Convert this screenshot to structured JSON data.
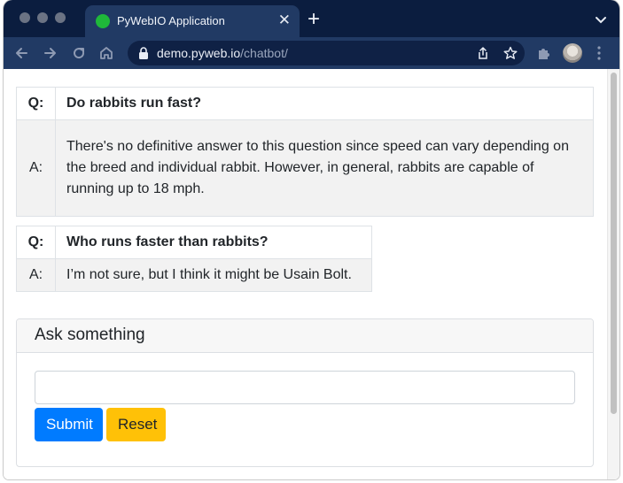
{
  "browser": {
    "tab_title": "PyWebIO Application",
    "tab_close_glyph": "✕",
    "new_tab_glyph": "+",
    "url_host": "demo.pyweb.io",
    "url_path": "/chatbot/",
    "favicon_color": "#1fb83a",
    "icons": [
      "back-arrow-icon",
      "forward-arrow-icon",
      "reload-icon",
      "home-icon",
      "lock-icon",
      "share-icon",
      "star-icon",
      "puzzle-extension-icon",
      "profile-avatar",
      "more-vert-icon",
      "tab-search-chevron-icon"
    ]
  },
  "chat": [
    {
      "q_label": "Q:",
      "question": "Do rabbits run fast?",
      "a_label": "A:",
      "answer": "There's no definitive answer to this question since speed can vary depending on the breed and individual rabbit. However, in general, rabbits are capable of running up to 18 mph."
    },
    {
      "q_label": "Q:",
      "question": "Who runs faster than rabbits?",
      "a_label": "A:",
      "answer": "I’m not sure, but I think it might be Usain Bolt."
    }
  ],
  "form": {
    "title": "Ask something",
    "input_value": "",
    "submit_label": "Submit",
    "reset_label": "Reset"
  },
  "colors": {
    "primary": "#007bff",
    "warning": "#ffc107",
    "chrome_dark": "#0b1d3f",
    "chrome_toolbar": "#213a64"
  }
}
